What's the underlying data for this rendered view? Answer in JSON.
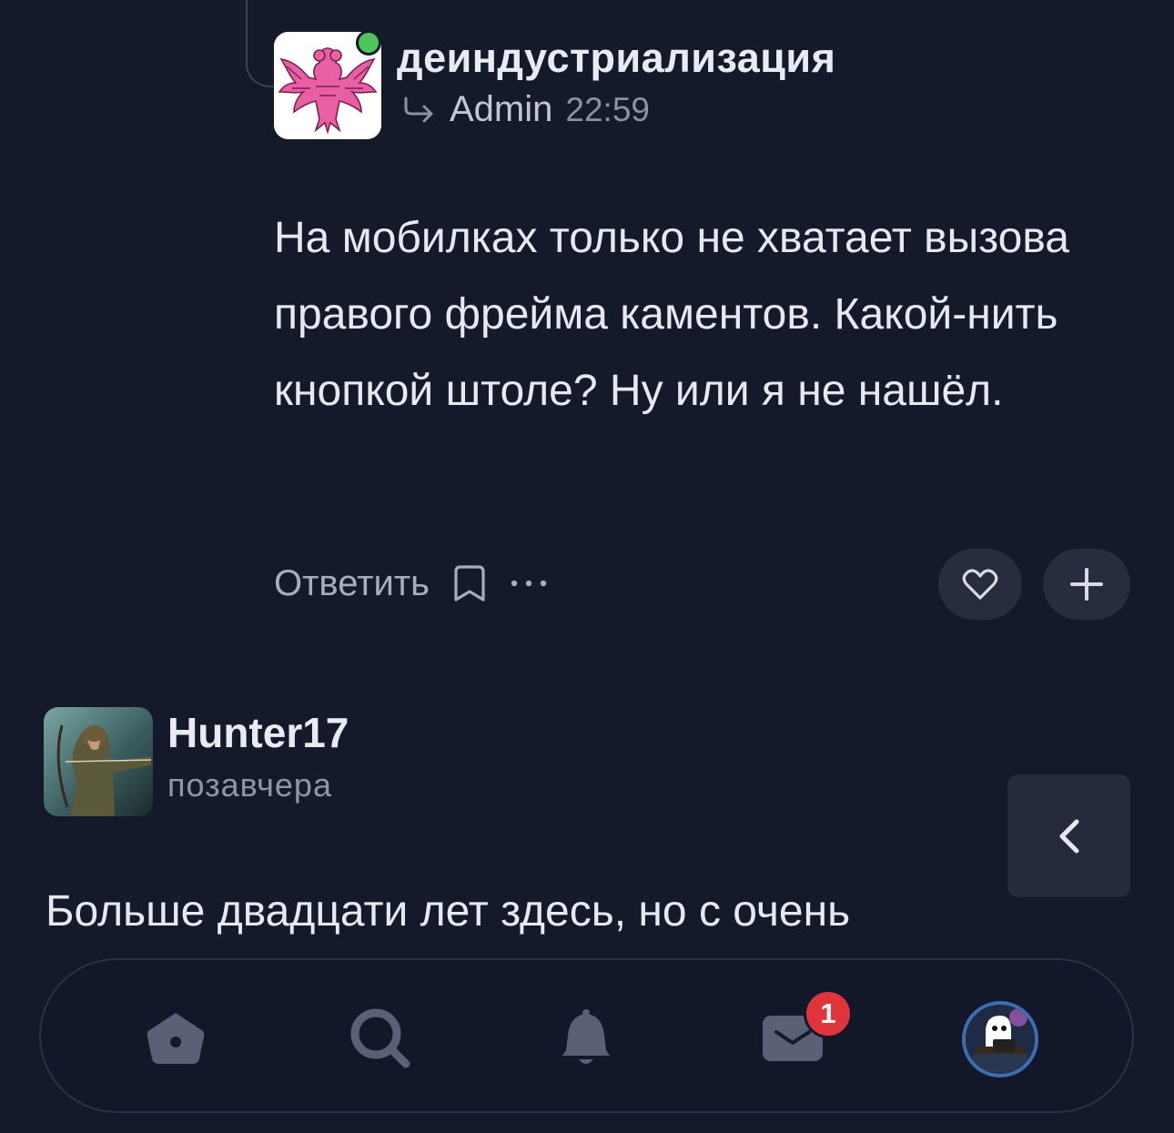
{
  "reply": {
    "author": "деиндустриализация",
    "reply_to": "Admin",
    "time": "22:59",
    "body": "На мобилках только не хватает вызова правого фрейма каментов. Какой-нить кнопкой штоле? Ну или я не нашёл.",
    "online": true
  },
  "actions": {
    "reply_label": "Ответить",
    "more_label": "···",
    "add_label": "+"
  },
  "comment": {
    "author": "Hunter17",
    "time": "позавчера",
    "body": "Больше двадцати лет здесь, но с очень"
  },
  "sidebar_toggle": {
    "label": "‹"
  },
  "nav": {
    "items": [
      {
        "icon": "home-icon"
      },
      {
        "icon": "search-icon"
      },
      {
        "icon": "bell-icon"
      },
      {
        "icon": "mail-icon",
        "badge": "1"
      },
      {
        "icon": "profile-avatar"
      }
    ]
  },
  "colors": {
    "background": "#151a2a",
    "card": "#272d3f",
    "online": "#4cc55a",
    "badge": "#e0343c",
    "accent_pink": "#e85fa4"
  }
}
